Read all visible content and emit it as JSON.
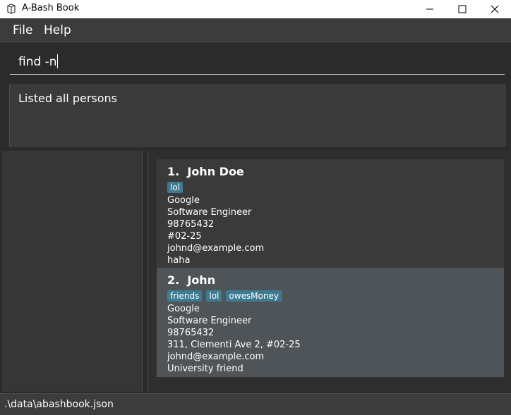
{
  "window": {
    "title": "A-Bash Book"
  },
  "menu": {
    "items": [
      "File",
      "Help"
    ]
  },
  "command": {
    "value": "find -n"
  },
  "result": {
    "text": "Listed all persons"
  },
  "persons": [
    {
      "index": "1.",
      "name": "John Doe",
      "tags": [
        "lol"
      ],
      "fields": [
        "Google",
        "Software Engineer",
        "98765432",
        "#02-25",
        "johnd@example.com",
        "haha"
      ]
    },
    {
      "index": "2.",
      "name": "John",
      "tags": [
        "friends",
        "lol",
        "owesMoney"
      ],
      "fields": [
        "Google",
        "Software Engineer",
        "98765432",
        "311, Clementi Ave 2, #02-25",
        "johnd@example.com",
        "University friend"
      ]
    }
  ],
  "status": {
    "path": ".\\data\\abashbook.json"
  },
  "colors": {
    "tag_bg": "#3e7b91",
    "selected_card_bg": "#4f5458",
    "card_bg": "#3a3a3a"
  }
}
